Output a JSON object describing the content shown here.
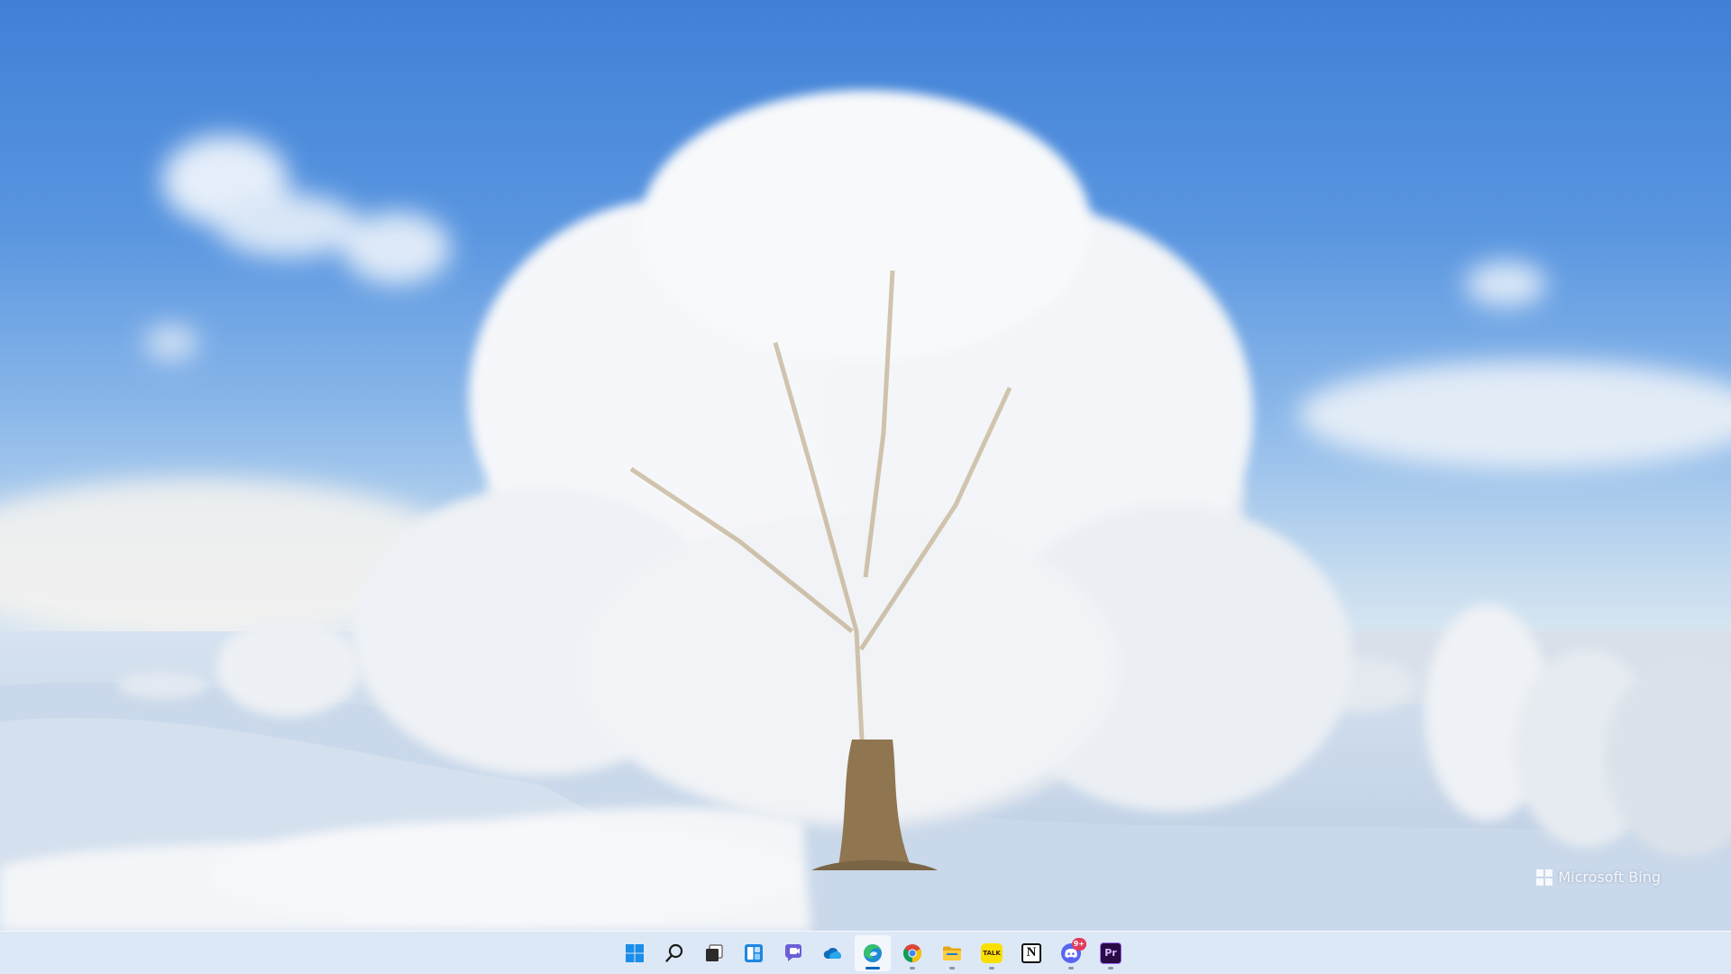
{
  "wallpaper": {
    "watermark_text": "Microsoft Bing",
    "watermark_icon": "windows-logo-icon",
    "subject": "frost-covered tree in snowy field under blue sky"
  },
  "taskbar": {
    "accent_color": "#0067c0",
    "items": [
      {
        "name": "start",
        "icon": "windows-start-icon",
        "active": false,
        "running": false
      },
      {
        "name": "search",
        "icon": "search-icon",
        "active": false,
        "running": false
      },
      {
        "name": "task-view",
        "icon": "task-view-icon",
        "active": false,
        "running": false
      },
      {
        "name": "widgets",
        "icon": "widgets-icon",
        "active": false,
        "running": false
      },
      {
        "name": "chat",
        "icon": "teams-chat-icon",
        "active": false,
        "running": false
      },
      {
        "name": "onedrive",
        "icon": "onedrive-icon",
        "active": false,
        "running": false
      },
      {
        "name": "edge",
        "icon": "edge-icon",
        "active": true,
        "running": true
      },
      {
        "name": "chrome",
        "icon": "chrome-icon",
        "active": false,
        "running": true
      },
      {
        "name": "file-explorer",
        "icon": "folder-icon",
        "active": false,
        "running": true
      },
      {
        "name": "kakaotalk",
        "icon": "kakaotalk-icon",
        "label": "TALK",
        "active": false,
        "running": true
      },
      {
        "name": "notion",
        "icon": "notion-icon",
        "label": "N",
        "active": false,
        "running": false
      },
      {
        "name": "discord",
        "icon": "discord-icon",
        "badge": "9+",
        "active": false,
        "running": true
      },
      {
        "name": "premiere-pro",
        "icon": "premiere-pro-icon",
        "label": "Pr",
        "active": false,
        "running": true
      }
    ]
  }
}
